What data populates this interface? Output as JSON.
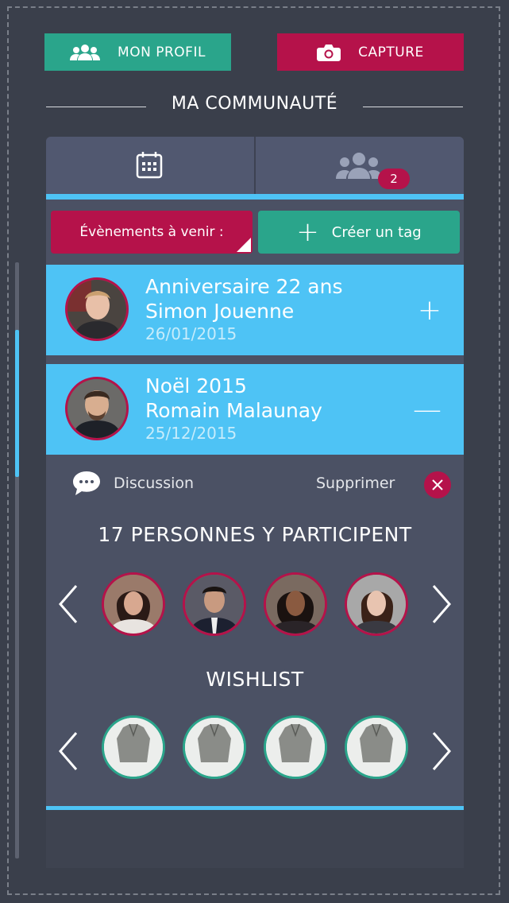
{
  "header": {
    "profile_label": "MON PROFIL",
    "capture_label": "CAPTURE",
    "community_title": "MA COMMUNAUTÉ"
  },
  "tabs": {
    "calendar_icon": "calendar-icon",
    "group_icon": "group-icon",
    "group_badge": "2"
  },
  "filters": {
    "events_label": "Évènements à venir :",
    "create_tag_label": "Créer un tag",
    "create_tag_plus": "+"
  },
  "events": [
    {
      "title": "Anniversaire 22 ans",
      "name": "Simon Jouenne",
      "date": "26/01/2015",
      "action": "+"
    },
    {
      "title": "Noël 2015",
      "name": "Romain Malaunay",
      "date": "25/12/2015",
      "action": "—"
    }
  ],
  "details": {
    "discussion_label": "Discussion",
    "delete_label": "Supprimer",
    "participants_title": "17 PERSONNES Y PARTICIPENT",
    "wishlist_title": "WISHLIST"
  },
  "colors": {
    "background": "#3a3f4b",
    "card": "#4b5164",
    "accent_blue": "#4ec3f5",
    "accent_green": "#2aa58b",
    "accent_red": "#b5124a"
  }
}
